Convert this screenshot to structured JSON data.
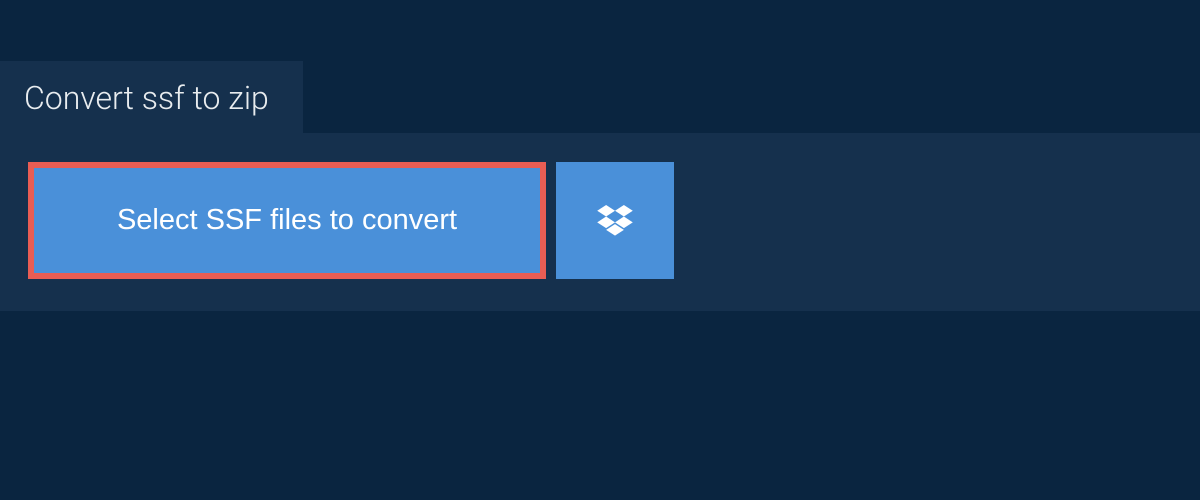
{
  "tab": {
    "label": "Convert ssf to zip"
  },
  "actions": {
    "select_button_label": "Select SSF files to convert"
  },
  "colors": {
    "page_bg": "#0a2540",
    "panel_bg": "#15304d",
    "button_bg": "#4a90d9",
    "highlight_border": "#e85d54",
    "text": "#ffffff"
  },
  "icons": {
    "dropbox": "dropbox-icon"
  }
}
